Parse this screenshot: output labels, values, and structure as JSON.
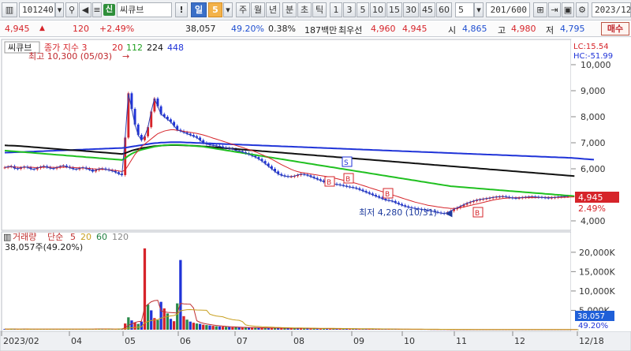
{
  "toolbar": {
    "code": "101240",
    "market_badge": "신",
    "name": "씨큐브",
    "period_buttons": [
      "일",
      "5",
      "주",
      "월",
      "년",
      "분",
      "초",
      "틱"
    ],
    "minute_buttons": [
      "1",
      "3",
      "5",
      "10",
      "15",
      "30",
      "45",
      "60"
    ],
    "interval_value": "5",
    "count": "201",
    "count_total": "/600",
    "date": "2023/12"
  },
  "quote": {
    "price": "4,945",
    "change": "120",
    "change_pct": "+2.49%",
    "volume": "38,057",
    "volume_ratio": "49.20%",
    "turnover": "0.38%",
    "amount": "187백만",
    "best_bid_label": "최우선",
    "best_ask": "4,960",
    "best_bid": "4,945",
    "open_label": "시",
    "open": "4,865",
    "high_label": "고",
    "high": "4,980",
    "low_label": "저",
    "low": "4,795",
    "buy_button": "매수"
  },
  "price_panel": {
    "tag": "씨큐브",
    "legend_label": "종가 지수 3",
    "legend_ma": [
      "20",
      "112",
      "224",
      "448"
    ],
    "ma_colors": [
      "#d6242a",
      "#20c020",
      "#111111",
      "#1f33d8"
    ],
    "max_annotation": "최고 10,300 (05/03)",
    "min_annotation": "최저 4,280 (10/31)",
    "lc": "LC:15.54",
    "hc": "HC:-51.99",
    "axis_ticks": [
      "10,000",
      "9,000",
      "8,000",
      "7,000",
      "6,000",
      "4,000"
    ],
    "current_price_tag": "4,945",
    "current_pct_tag": "2.49%",
    "signal_b": "B",
    "signal_s": "S"
  },
  "volume_panel": {
    "title": "거래량",
    "legend_type": "단순",
    "legend_ma": [
      "5",
      "20",
      "60",
      "120"
    ],
    "ma_colors": [
      "#c03030",
      "#c8a020",
      "#208040",
      "#888888"
    ],
    "current_value": "38,057주(49.20%)",
    "axis_ticks": [
      "20,000K",
      "15,000K",
      "10,000K",
      "5,000K"
    ],
    "volume_tag": "38,057",
    "volume_pct_tag": "49.20%"
  },
  "x_axis": {
    "labels": [
      "2023/02",
      "04",
      "05",
      "06",
      "07",
      "08",
      "09",
      "10",
      "11",
      "12",
      "12/18"
    ]
  },
  "chart_data": {
    "type": "line",
    "price_axis": {
      "min": 4000,
      "max": 10000
    },
    "months": [
      "2023/02",
      "04",
      "05",
      "06",
      "07",
      "08",
      "09",
      "10",
      "11",
      "12"
    ],
    "close": [
      6050,
      6080,
      6100,
      6020,
      6000,
      6040,
      6080,
      6050,
      6000,
      5980,
      6030,
      6070,
      6100,
      6060,
      6020,
      6010,
      6050,
      6090,
      6120,
      6080,
      6040,
      6000,
      5980,
      6020,
      6050,
      6010,
      5970,
      5900,
      5950,
      6000,
      6010,
      5980,
      5950,
      5920,
      5870,
      5810,
      5760,
      7200,
      8900,
      8300,
      7700,
      7300,
      7100,
      7250,
      7600,
      8200,
      8700,
      8400,
      8100,
      8000,
      7900,
      7800,
      7650,
      7500,
      7450,
      7400,
      7350,
      7300,
      7250,
      7200,
      7100,
      7000,
      6950,
      6920,
      6900,
      6880,
      6860,
      6820,
      6800,
      6780,
      6760,
      6700,
      6680,
      6640,
      6600,
      6560,
      6500,
      6450,
      6380,
      6300,
      6200,
      6100,
      6000,
      5900,
      5800,
      5750,
      5720,
      5700,
      5700,
      5720,
      5760,
      5800,
      5780,
      5750,
      5700,
      5650,
      5600,
      5550,
      5500,
      5480,
      5450,
      5420,
      5400,
      5380,
      5350,
      5320,
      5300,
      5280,
      5250,
      5200,
      5150,
      5100,
      5050,
      5000,
      4950,
      4900,
      4850,
      4800,
      4780,
      4760,
      4700,
      4650,
      4600,
      4560,
      4520,
      4500,
      4480,
      4460,
      4440,
      4420,
      4400,
      4380,
      4350,
      4320,
      4300,
      4280,
      4320,
      4380,
      4450,
      4500,
      4560,
      4620,
      4680,
      4720,
      4760,
      4800,
      4820,
      4840,
      4860,
      4880,
      4900,
      4920,
      4930,
      4940,
      4920,
      4900,
      4880,
      4870,
      4880,
      4900,
      4910,
      4920,
      4930,
      4920,
      4910,
      4900,
      4890,
      4880,
      4890,
      4900,
      4920,
      4930,
      4940,
      4945
    ],
    "ma20": [
      6050,
      6060,
      6080,
      6070,
      6060,
      6055,
      6060,
      6065,
      6060,
      6050,
      6045,
      6050,
      6060,
      6065,
      6060,
      6055,
      6050,
      6055,
      6060,
      6065,
      6060,
      6050,
      6040,
      6035,
      6030,
      6025,
      6015,
      6000,
      5990,
      5985,
      5980,
      5975,
      5965,
      5950,
      5935,
      5915,
      5895,
      5950,
      6150,
      6350,
      6550,
      6700,
      6850,
      6950,
      7050,
      7150,
      7250,
      7350,
      7400,
      7450,
      7480,
      7500,
      7500,
      7480,
      7460,
      7440,
      7420,
      7400,
      7380,
      7360,
      7330,
      7300,
      7260,
      7220,
      7180,
      7140,
      7100,
      7060,
      7020,
      6980,
      6940,
      6900,
      6860,
      6820,
      6780,
      6740,
      6700,
      6650,
      6600,
      6550,
      6490,
      6430,
      6370,
      6300,
      6230,
      6160,
      6100,
      6040,
      5980,
      5930,
      5890,
      5860,
      5840,
      5820,
      5800,
      5780,
      5760,
      5740,
      5720,
      5700,
      5680,
      5650,
      5620,
      5590,
      5560,
      5530,
      5500,
      5470,
      5440,
      5400,
      5360,
      5320,
      5280,
      5240,
      5200,
      5160,
      5120,
      5080,
      5040,
      5000,
      4960,
      4920,
      4880,
      4840,
      4800,
      4760,
      4720,
      4690,
      4660,
      4630,
      4600,
      4580,
      4560,
      4540,
      4520,
      4500,
      4490,
      4480,
      4480,
      4490,
      4510,
      4530,
      4560,
      4590,
      4620,
      4650,
      4680,
      4710,
      4740,
      4770,
      4800,
      4820,
      4840,
      4860,
      4870,
      4880,
      4885,
      4890,
      4890,
      4890,
      4890,
      4890,
      4890,
      4890,
      4895,
      4900,
      4900,
      4900,
      4900,
      4900,
      4900,
      4900,
      4905,
      4910,
      4915,
      4920
    ],
    "ma112": [
      6700,
      6690,
      6680,
      6670,
      6660,
      6650,
      6640,
      6630,
      6620,
      6610,
      6600,
      6590,
      6580,
      6570,
      6560,
      6550,
      6540,
      6530,
      6520,
      6510,
      6500,
      6490,
      6480,
      6470,
      6460,
      6450,
      6440,
      6430,
      6420,
      6410,
      6400,
      6390,
      6380,
      6370,
      6360,
      6350,
      6340,
      6400,
      6500,
      6580,
      6640,
      6690,
      6730,
      6760,
      6790,
      6820,
      6850,
      6870,
      6890,
      6900,
      6910,
      6920,
      6920,
      6920,
      6915,
      6910,
      6900,
      6890,
      6880,
      6870,
      6860,
      6850,
      6830,
      6810,
      6790,
      6770,
      6750,
      6730,
      6710,
      6690,
      6670,
      6650,
      6630,
      6610,
      6590,
      6570,
      6550,
      6530,
      6510,
      6490,
      6470,
      6450,
      6430,
      6410,
      6390,
      6370,
      6350,
      6330,
      6310,
      6290,
      6270,
      6250,
      6230,
      6210,
      6190,
      6170,
      6150,
      6130,
      6110,
      6090,
      6070,
      6050,
      6030,
      6010,
      5990,
      5970,
      5950,
      5930,
      5910,
      5890,
      5870,
      5850,
      5830,
      5810,
      5790,
      5770,
      5750,
      5730,
      5710,
      5690,
      5670,
      5650,
      5630,
      5610,
      5590,
      5570,
      5550,
      5530,
      5510,
      5490,
      5470,
      5450,
      5430,
      5410,
      5390,
      5370,
      5350,
      5330,
      5320,
      5310,
      5300,
      5290,
      5280,
      5270,
      5260,
      5250,
      5240,
      5230,
      5220,
      5210,
      5200,
      5190,
      5180,
      5170,
      5160,
      5150,
      5140,
      5130,
      5120,
      5110,
      5100,
      5090,
      5080,
      5070,
      5060,
      5050,
      5040,
      5030,
      5020,
      5010,
      5000,
      4990,
      4980,
      4970,
      4960,
      4950
    ],
    "ma224": [
      6900,
      6895,
      6890,
      6885,
      6880,
      6870,
      6860,
      6850,
      6840,
      6830,
      6820,
      6810,
      6800,
      6790,
      6780,
      6770,
      6760,
      6750,
      6740,
      6730,
      6720,
      6715,
      6710,
      6700,
      6690,
      6680,
      6670,
      6660,
      6650,
      6640,
      6630,
      6620,
      6610,
      6600,
      6590,
      6580,
      6570,
      6600,
      6650,
      6700,
      6730,
      6760,
      6790,
      6810,
      6830,
      6850,
      6870,
      6880,
      6890,
      6900,
      6905,
      6910,
      6910,
      6910,
      6905,
      6900,
      6895,
      6890,
      6885,
      6880,
      6870,
      6860,
      6850,
      6840,
      6830,
      6820,
      6810,
      6800,
      6790,
      6780,
      6770,
      6760,
      6750,
      6740,
      6730,
      6720,
      6710,
      6700,
      6690,
      6680,
      6670,
      6660,
      6650,
      6640,
      6630,
      6620,
      6610,
      6600,
      6590,
      6580,
      6570,
      6560,
      6550,
      6540,
      6530,
      6520,
      6510,
      6500,
      6490,
      6480,
      6470,
      6460,
      6450,
      6440,
      6430,
      6420,
      6410,
      6400,
      6390,
      6380,
      6370,
      6360,
      6350,
      6340,
      6330,
      6320,
      6310,
      6300,
      6290,
      6280,
      6270,
      6260,
      6250,
      6240,
      6230,
      6220,
      6210,
      6200,
      6190,
      6180,
      6170,
      6160,
      6150,
      6140,
      6130,
      6120,
      6110,
      6100,
      6090,
      6080,
      6070,
      6060,
      6050,
      6040,
      6030,
      6020,
      6010,
      6000,
      5990,
      5980,
      5970,
      5960,
      5950,
      5940,
      5930,
      5920,
      5910,
      5900,
      5890,
      5880,
      5870,
      5860,
      5850,
      5840,
      5830,
      5820,
      5810,
      5800,
      5790,
      5780,
      5770,
      5760,
      5750,
      5740,
      5730,
      5720
    ],
    "ma448": [
      6620,
      6625,
      6630,
      6635,
      6640,
      6645,
      6650,
      6655,
      6660,
      6665,
      6670,
      6675,
      6680,
      6685,
      6690,
      6695,
      6700,
      6705,
      6710,
      6715,
      6720,
      6725,
      6730,
      6735,
      6740,
      6745,
      6750,
      6755,
      6760,
      6765,
      6770,
      6775,
      6780,
      6785,
      6790,
      6795,
      6800,
      6810,
      6830,
      6850,
      6870,
      6890,
      6910,
      6930,
      6950,
      6970,
      6985,
      6995,
      7005,
      7010,
      7015,
      7020,
      7020,
      7020,
      7020,
      7015,
      7010,
      7005,
      7000,
      6995,
      6990,
      6985,
      6980,
      6975,
      6970,
      6965,
      6960,
      6955,
      6950,
      6945,
      6940,
      6935,
      6930,
      6925,
      6920,
      6915,
      6910,
      6905,
      6900,
      6895,
      6890,
      6885,
      6880,
      6875,
      6870,
      6865,
      6860,
      6855,
      6850,
      6845,
      6840,
      6835,
      6830,
      6825,
      6820,
      6815,
      6810,
      6805,
      6800,
      6795,
      6790,
      6785,
      6780,
      6775,
      6770,
      6765,
      6760,
      6755,
      6750,
      6745,
      6740,
      6735,
      6730,
      6725,
      6720,
      6715,
      6710,
      6705,
      6700,
      6695,
      6690,
      6685,
      6680,
      6675,
      6670,
      6665,
      6660,
      6655,
      6650,
      6645,
      6640,
      6635,
      6630,
      6625,
      6620,
      6615,
      6610,
      6605,
      6600,
      6595,
      6590,
      6585,
      6580,
      6575,
      6570,
      6565,
      6560,
      6555,
      6550,
      6545,
      6540,
      6535,
      6530,
      6525,
      6520,
      6515,
      6510,
      6505,
      6500,
      6495,
      6490,
      6485,
      6480,
      6475,
      6470,
      6465,
      6460,
      6455,
      6450,
      6445,
      6440,
      6435,
      6430,
      6425,
      6420,
      6410,
      6400,
      6390,
      6380,
      6370,
      6360,
      6350
    ],
    "volume_axis": {
      "min": 0,
      "max": 22000
    },
    "volume_k": [
      180,
      150,
      200,
      170,
      160,
      140,
      210,
      190,
      150,
      130,
      170,
      200,
      160,
      150,
      140,
      180,
      160,
      150,
      170,
      190,
      160,
      140,
      150,
      130,
      170,
      160,
      150,
      200,
      260,
      220,
      180,
      160,
      150,
      170,
      190,
      230,
      300,
      1600,
      3200,
      2400,
      1800,
      1500,
      2100,
      21000,
      6500,
      5000,
      3000,
      2500,
      7200,
      5500,
      4200,
      2800,
      2200,
      6800,
      18000,
      3500,
      2600,
      2100,
      1800,
      1600,
      1500,
      1300,
      1200,
      1100,
      1000,
      900,
      850,
      800,
      760,
      700,
      650,
      620,
      600,
      580,
      560,
      540,
      520,
      500,
      480,
      460,
      450,
      440,
      430,
      420,
      410,
      400,
      390,
      380,
      370,
      360,
      350,
      340,
      330,
      320,
      310,
      300,
      300,
      290,
      280,
      270,
      260,
      250,
      250,
      240,
      230,
      220,
      210,
      200,
      200,
      190,
      180,
      180,
      170,
      160,
      160,
      150,
      150,
      140,
      140,
      130,
      130,
      120,
      120,
      110,
      110,
      100,
      100,
      95,
      90,
      90,
      85,
      80,
      80,
      75,
      70,
      70,
      65,
      60,
      60,
      55,
      55,
      50,
      50,
      48,
      46,
      45,
      44,
      43,
      42,
      41,
      40,
      40,
      39,
      39,
      38,
      38,
      38,
      38,
      38,
      38,
      38,
      38,
      38,
      38,
      38,
      38,
      38,
      38,
      38,
      38,
      38,
      38,
      38,
      38,
      38,
      38,
      38
    ]
  }
}
